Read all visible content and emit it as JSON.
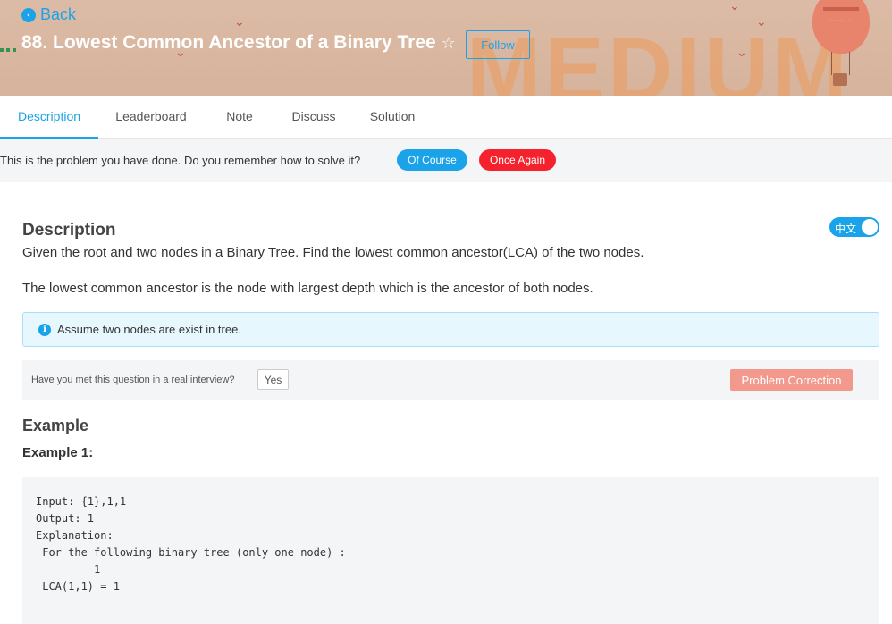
{
  "header": {
    "back_label": "Back",
    "title": "88. Lowest Common Ancestor of a Binary Tree",
    "follow_label": "Follow",
    "difficulty_watermark": "MEDIUM",
    "balloon_text": "......"
  },
  "tabs": [
    {
      "label": "Description",
      "active": true
    },
    {
      "label": "Leaderboard",
      "active": false
    },
    {
      "label": "Note",
      "active": false
    },
    {
      "label": "Discuss",
      "active": false
    },
    {
      "label": "Solution",
      "active": false
    }
  ],
  "remember": {
    "text": "This is the problem you have done. Do you remember how to solve it?",
    "of_course_label": "Of Course",
    "once_again_label": "Once Again"
  },
  "description": {
    "heading": "Description",
    "language_toggle": "中文",
    "paragraph1": "Given the root and two nodes in a Binary Tree. Find the lowest common ancestor(LCA) of the two nodes.",
    "paragraph2": "The lowest common ancestor is the node with largest depth which is the ancestor of both nodes.",
    "info_icon_glyph": "i",
    "info_text": "Assume two nodes are exist in tree."
  },
  "interview": {
    "question": "Have you met this question in a real interview?",
    "yes_label": "Yes",
    "correction_label": "Problem Correction"
  },
  "example": {
    "heading": "Example",
    "example1_heading": "Example 1:",
    "code_lines": [
      "Input: {1},1,1",
      "Output: 1",
      "Explanation:",
      " For the following binary tree (only one node) :",
      "         1",
      " LCA(1,1) = 1"
    ]
  },
  "colors": {
    "accent": "#1aa3e8",
    "danger": "#f5222d",
    "correction": "#f3988c",
    "banner": "#d9b8a3"
  }
}
